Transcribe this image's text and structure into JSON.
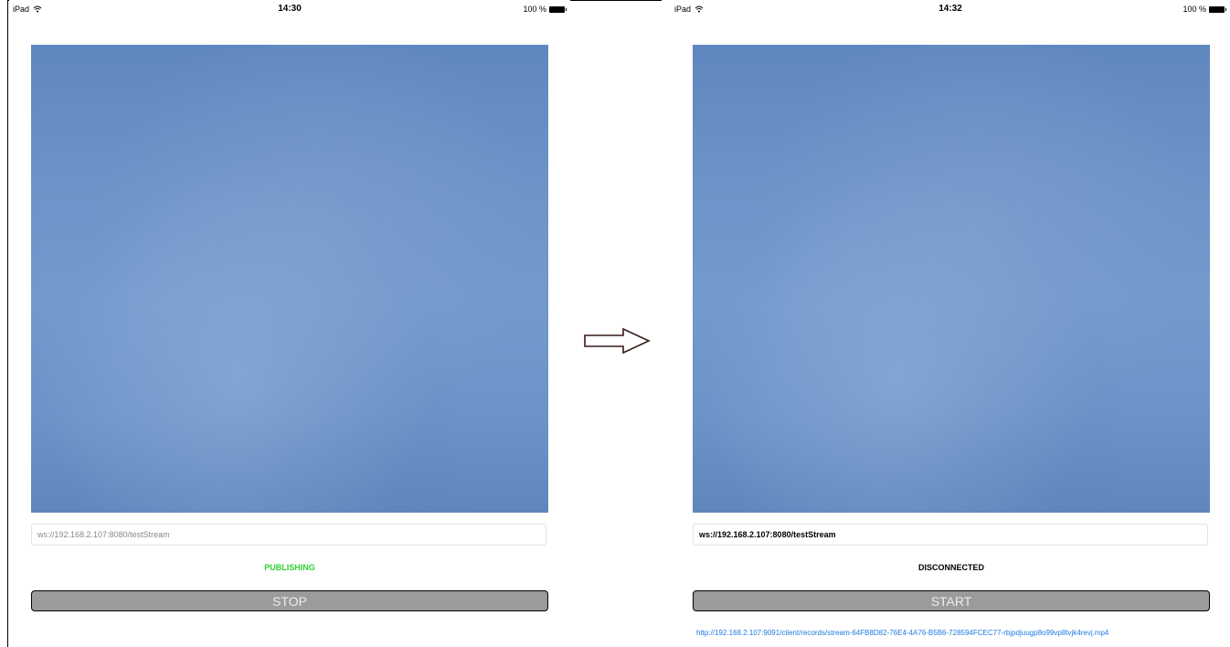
{
  "left_screen": {
    "status_bar": {
      "device": "iPad",
      "time": "14:30",
      "battery": "100 %"
    },
    "url_value": "ws://192.168.2.107:8080/testStream",
    "status_text": "PUBLISHING",
    "button_label": "STOP"
  },
  "right_screen": {
    "status_bar": {
      "device": "iPad",
      "time": "14:32",
      "battery": "100 %"
    },
    "url_value": "ws://192.168.2.107:8080/testStream",
    "status_text": "DISCONNECTED",
    "button_label": "START",
    "record_link": "http://192.168.2.107:9091/client/records/stream-64FB8D82-76E4-4A76-B5B6-728594FCEC77-rbjpdjuugp8o99vp8tvjk4revj.mp4"
  },
  "colors": {
    "publishing": "#2fd02f",
    "link": "#1f7ae0",
    "button": "#9b9b9b",
    "video": "#6d93c8"
  },
  "icons": [
    "wifi-icon",
    "battery-icon",
    "arrow-right-icon"
  ]
}
